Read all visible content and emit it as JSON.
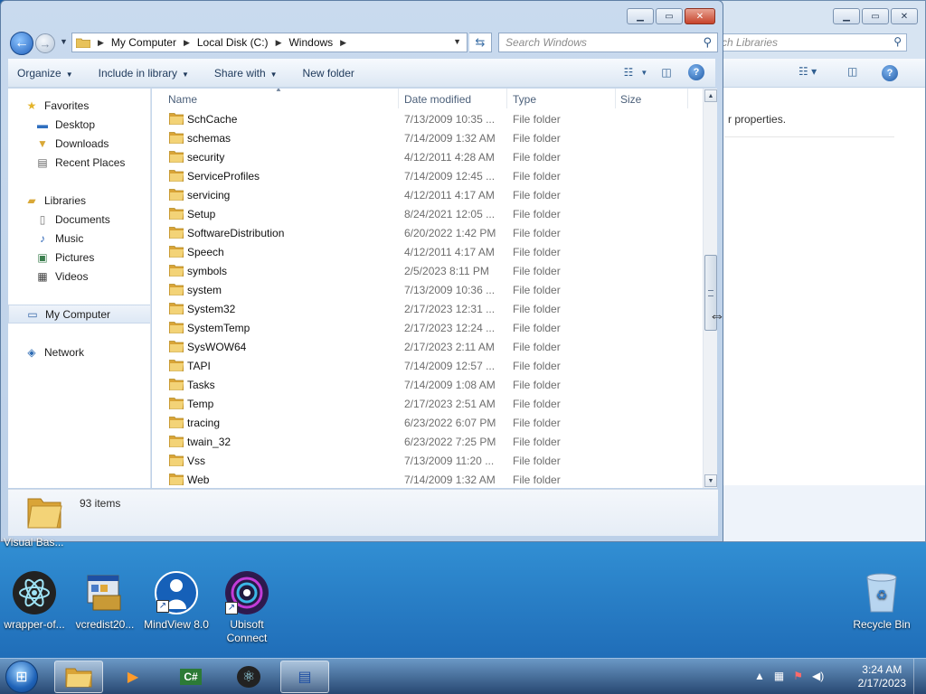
{
  "background_window": {
    "search_placeholder": "ch Libraries",
    "hint_text": "r properties."
  },
  "window": {
    "nav": {
      "breadcrumbs": [
        "My Computer",
        "Local Disk (C:)",
        "Windows"
      ],
      "search_placeholder": "Search Windows"
    },
    "toolbar": {
      "organize": "Organize",
      "include_in_library": "Include in library",
      "share_with": "Share with",
      "new_folder": "New folder"
    },
    "navpane": {
      "favorites": "Favorites",
      "desktop": "Desktop",
      "downloads": "Downloads",
      "recent_places": "Recent Places",
      "libraries": "Libraries",
      "documents": "Documents",
      "music": "Music",
      "pictures": "Pictures",
      "videos": "Videos",
      "my_computer": "My Computer",
      "network": "Network"
    },
    "columns": {
      "name": "Name",
      "date_modified": "Date modified",
      "type": "Type",
      "size": "Size"
    },
    "files": [
      {
        "name": "SchCache",
        "date": "7/13/2009 10:35 ...",
        "type": "File folder"
      },
      {
        "name": "schemas",
        "date": "7/14/2009 1:32 AM",
        "type": "File folder"
      },
      {
        "name": "security",
        "date": "4/12/2011 4:28 AM",
        "type": "File folder"
      },
      {
        "name": "ServiceProfiles",
        "date": "7/14/2009 12:45 ...",
        "type": "File folder"
      },
      {
        "name": "servicing",
        "date": "4/12/2011 4:17 AM",
        "type": "File folder"
      },
      {
        "name": "Setup",
        "date": "8/24/2021 12:05 ...",
        "type": "File folder"
      },
      {
        "name": "SoftwareDistribution",
        "date": "6/20/2022 1:42 PM",
        "type": "File folder"
      },
      {
        "name": "Speech",
        "date": "4/12/2011 4:17 AM",
        "type": "File folder"
      },
      {
        "name": "symbols",
        "date": "2/5/2023 8:11 PM",
        "type": "File folder"
      },
      {
        "name": "system",
        "date": "7/13/2009 10:36 ...",
        "type": "File folder"
      },
      {
        "name": "System32",
        "date": "2/17/2023 12:31 ...",
        "type": "File folder"
      },
      {
        "name": "SystemTemp",
        "date": "2/17/2023 12:24 ...",
        "type": "File folder"
      },
      {
        "name": "SysWOW64",
        "date": "2/17/2023 2:11 AM",
        "type": "File folder"
      },
      {
        "name": "TAPI",
        "date": "7/14/2009 12:57 ...",
        "type": "File folder"
      },
      {
        "name": "Tasks",
        "date": "7/14/2009 1:08 AM",
        "type": "File folder"
      },
      {
        "name": "Temp",
        "date": "2/17/2023 2:51 AM",
        "type": "File folder"
      },
      {
        "name": "tracing",
        "date": "6/23/2022 6:07 PM",
        "type": "File folder"
      },
      {
        "name": "twain_32",
        "date": "6/23/2022 7:25 PM",
        "type": "File folder"
      },
      {
        "name": "Vss",
        "date": "7/13/2009 11:20 ...",
        "type": "File folder"
      },
      {
        "name": "Web",
        "date": "7/14/2009 1:32 AM",
        "type": "File folder"
      }
    ],
    "status": {
      "item_count": "93 items"
    }
  },
  "desktop": {
    "cut_label": "Visual Bas...",
    "icons": [
      {
        "label": "wrapper-of...",
        "icon": "atom-icon"
      },
      {
        "label": "vcredist20...",
        "icon": "installer-icon"
      },
      {
        "label": "MindView 8.0",
        "icon": "mindview-icon"
      },
      {
        "label": "Ubisoft Connect",
        "icon": "ubisoft-icon"
      }
    ],
    "recycle_bin": "Recycle Bin"
  },
  "taskbar": {
    "time": "3:24 AM",
    "date": "2/17/2023"
  },
  "colors": {
    "folder_yellow": "#e8c25a",
    "selection_blue": "#dde8f5",
    "desktop_blue": "#2a86d0"
  }
}
